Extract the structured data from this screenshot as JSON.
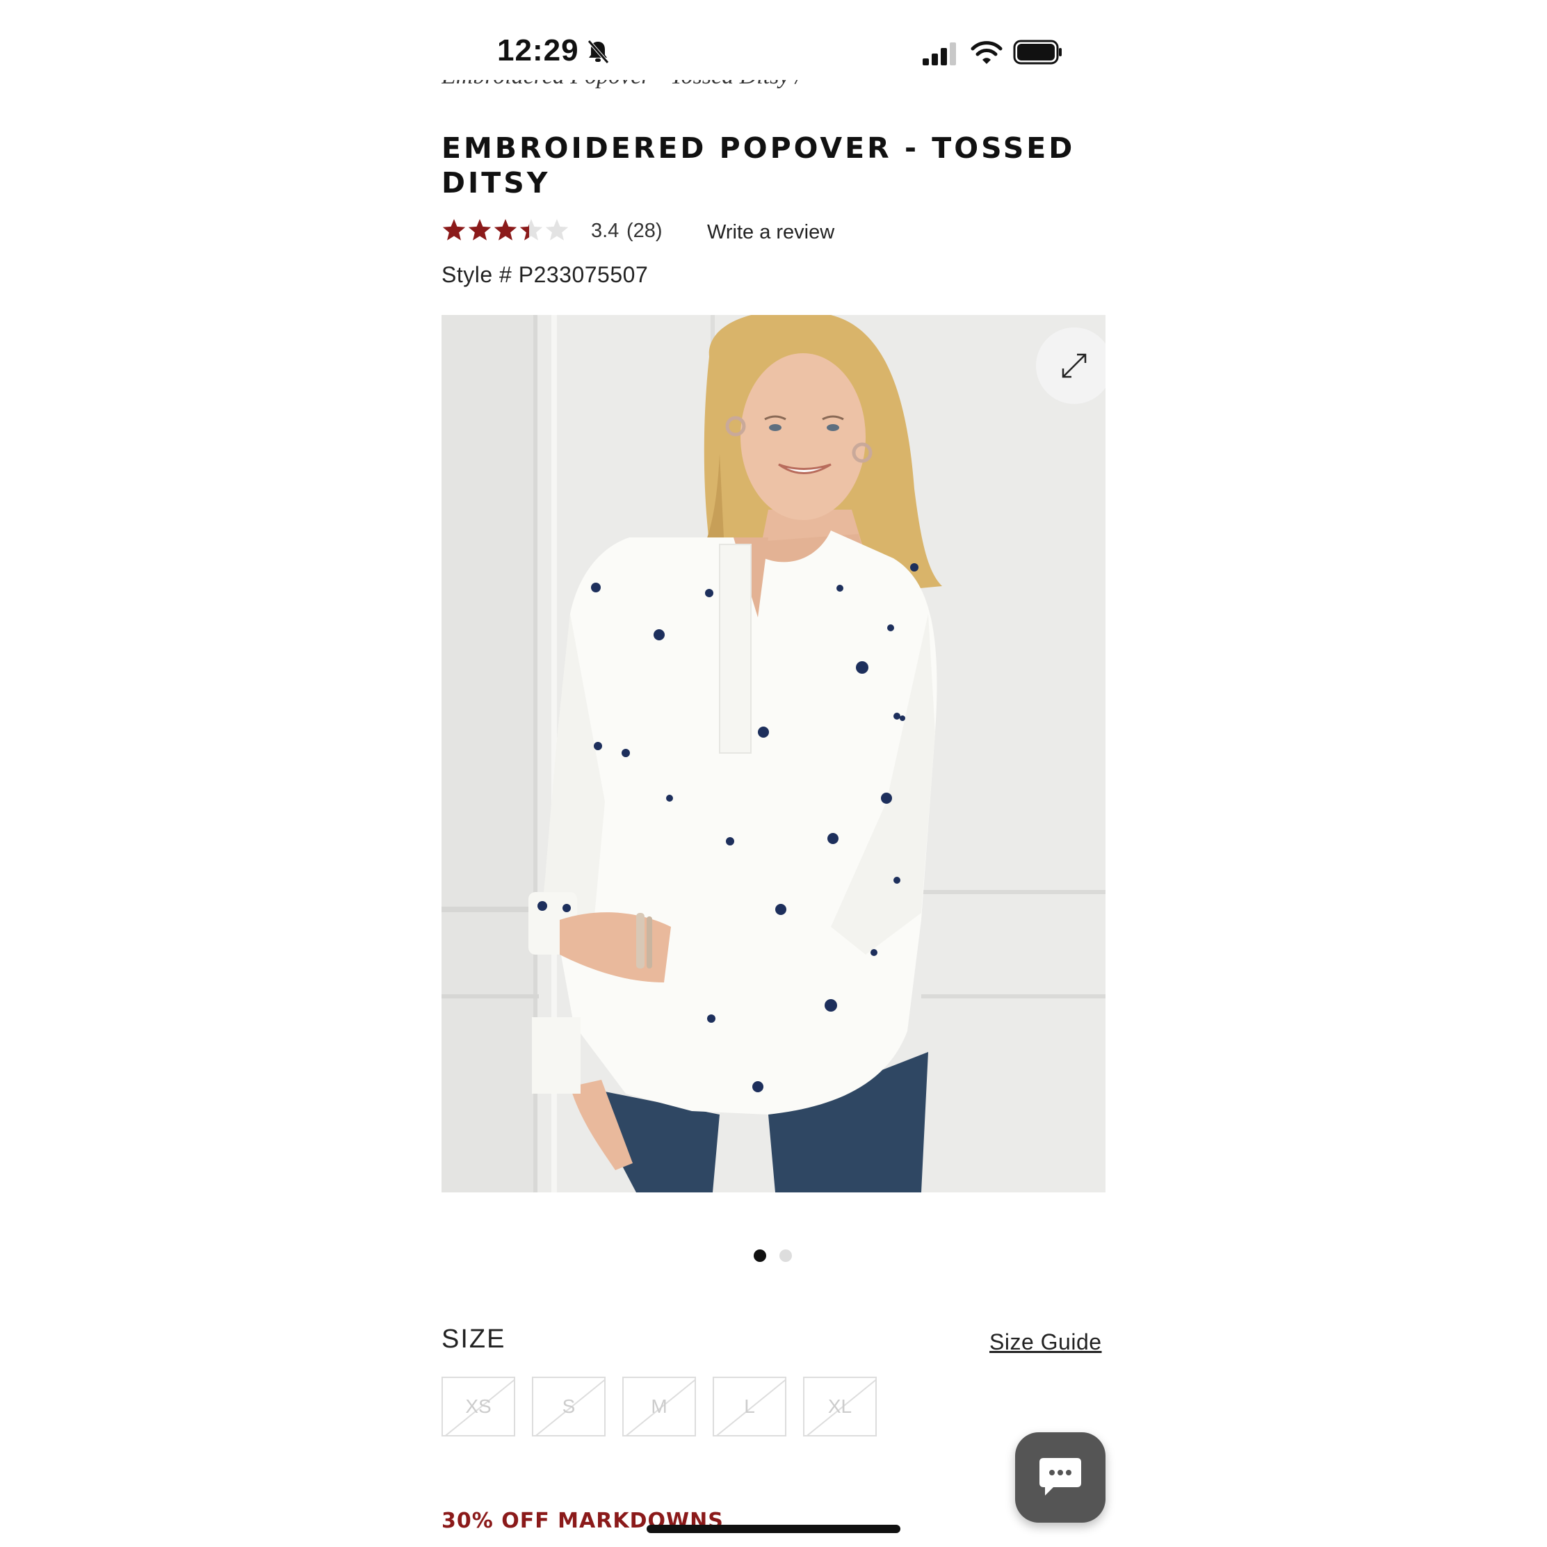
{
  "status_bar": {
    "time": "12:29"
  },
  "breadcrumb": {
    "text": "Embroidered Popover - Tossed Ditsy /"
  },
  "product": {
    "title": "EMBROIDERED POPOVER - TOSSED DITSY",
    "rating_value": "3.4",
    "rating_count": "(28)",
    "rating_stars": 3.4,
    "write_review_label": "Write a review",
    "style_number": "Style # P233075507",
    "image_alt": "Woman wearing white embroidered popover with navy tossed ditsy flowers and jeans",
    "gallery_count": 2,
    "gallery_active_index": 0
  },
  "size_section": {
    "label": "SIZE",
    "guide_label": "Size Guide",
    "options": [
      "XS",
      "S",
      "M",
      "L",
      "XL"
    ],
    "all_unavailable": true
  },
  "promo": {
    "text": "30% OFF MARKDOWNS"
  },
  "colors": {
    "star_filled": "#8b1a1a",
    "star_empty": "#e3e3e3",
    "promo": "#8b1a1a",
    "chat_button": "#555555"
  }
}
